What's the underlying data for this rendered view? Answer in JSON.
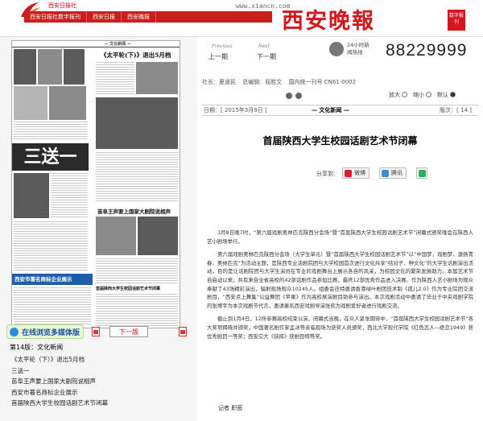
{
  "header": {
    "site_name": "西安日报社",
    "site_url": "www.xiancn.com",
    "nav": [
      "西安日报社数字报刊",
      "西安日报",
      "西安晚报"
    ],
    "masthead": "西安晚報",
    "masthead_badge": "数字报刊",
    "hotline_label": "24小时新闻热线",
    "hotline_number": "88229999"
  },
  "pager": {
    "prev_caption": "Previous",
    "next_caption": "Next",
    "prev_label": "上一期",
    "next_label": "下一期"
  },
  "info_bar": {
    "publisher": "社长：夏道民",
    "editor": "总编辑：屈胜文",
    "issn": "国内统一刊号 CN61-0002"
  },
  "zoom": {
    "zoom_in": "放大",
    "reset": "缩小",
    "default": "默认",
    "selected": "默认"
  },
  "date_bar": {
    "date": "日期：[ 2015年3月9日 ]",
    "section": "— 文化新闻 —",
    "page": "版次：[ 14 ]"
  },
  "article": {
    "title": "首届陕西大学生校园话剧艺术节闭幕",
    "share_label": "分享到：",
    "share_buttons": [
      "微博",
      "腾讯"
    ],
    "paragraphs": [
      "3月8日晚7时，“第六届戏剧奥林匹克陕西分会场”暨“首届陕西大学生校园话剧艺术节”闭幕式颁奖晚会在陕西人艺小剧场举行。",
      "第六届戏剧奥林匹克陕西分会场（大学生单元）暨“首届陕西大学生校园话剧艺术节”以“中国梦，戏剧梦，激扬青春，奥林匹克”为活动主题，是陕西专业话剧院团与大学校园首次进行文化共享“结对子、种文化”的大学生话剧演出活动，目的是让话剧院团与大学生演员在专业的戏剧舞台上展示各自的风采，为校园文化的繁荣发展助力。本届艺术节自启动以来，共有来自全省高校的42部话剧作品参加比赛，最终12部优秀作品进入决赛。作为陕西人艺小剧场为观众奉献了43场精彩演出，辐射现场观众10245人。组委会还特邀请香港绿叶剧团技术制《孤儿2.0》作为专业院团交流剧目，“西安点上舞集”公益舞团《苹果》作为高校展演剧目助参与演出。本次戏剧活动中邀请了毕业于中央戏剧学院的张博宇为本次戏剧节代言，邀请著名西安戏剧导演张奕为戏剧爱好者进行戏剧交流。",
      "截止到1月4日，12所参赛高校结束公演，闭幕式当晚，在众人紧张期待中，“首届陕西大学生校园话剧艺术节”各大奖项揭晓并颁奖，中国著名剧作家孟冰等亲临现场为获奖人员颁奖，西北大学现代学院《红色恋人—绝恋1949》获优秀剧目一等奖；西安交大《抉择》获剧目特等奖。"
    ],
    "author": "记者 职茵"
  },
  "edition": {
    "title": "第14版：文化新闻",
    "view_button": "在线浏览多媒体版",
    "next_page_button": "下一版",
    "items": [
      "《太平轮（下）》退出5月档",
      "三送一",
      "苗阜王声要上国家大剧院说相声",
      "西安市著名商标企业展示",
      "首届陕西大学生校园话剧艺术节闭幕"
    ]
  },
  "newspaper_page": {
    "headline_1": "《太平轮(下)》退出5月档",
    "headline_2": "三送一",
    "headline_3": "苗阜王声要上国家大剧院说相声",
    "headline_4": "首届陕西大学生校园话剧艺术节闭幕",
    "banner": "西安市著名商标企业展示"
  },
  "colors": {
    "brand_red": "#d6161d",
    "nav_red": "#c81f1f",
    "link_blue": "#1b4f9c",
    "banner_blue": "#1c5fa8"
  }
}
